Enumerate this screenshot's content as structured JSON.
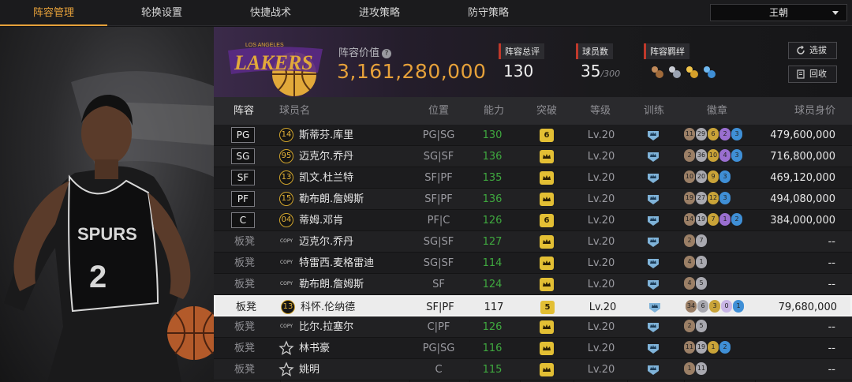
{
  "tabs": [
    {
      "label": "阵容管理",
      "active": true
    },
    {
      "label": "轮换设置",
      "active": false
    },
    {
      "label": "快捷战术",
      "active": false
    },
    {
      "label": "进攻策略",
      "active": false
    },
    {
      "label": "防守策略",
      "active": false
    }
  ],
  "team_select": {
    "value": "王朝"
  },
  "header": {
    "logo_icon": "lakers-logo",
    "value_label": "阵容价值",
    "value_help_icon": "help-icon",
    "value_amount": "3,161,280,000",
    "rating_label": "阵容总评",
    "rating_value": "130",
    "count_label": "球员数",
    "count_value": "35",
    "count_max": "/300",
    "bond_label": "阵容羁绊",
    "bond_icons": [
      "bond-icon-bronze",
      "bond-icon-silver",
      "bond-icon-gold",
      "bond-icon-blue"
    ]
  },
  "buttons": {
    "select": "选拔",
    "recycle": "回收"
  },
  "columns": {
    "lineup": "阵容",
    "name": "球员名",
    "position": "位置",
    "power": "能力",
    "breakthrough": "突破",
    "level": "等级",
    "training": "训练",
    "badges": "徽章",
    "value": "球员身价"
  },
  "colors": {
    "accent": "#e6a13a",
    "power": "#3fa83f",
    "break": "#e3bf34"
  },
  "players": [
    {
      "slot": "PG",
      "starter": true,
      "num": "14",
      "name": "斯蒂芬.库里",
      "pos": "PG|SG",
      "power": "130",
      "brk": "6",
      "level": "Lv.20",
      "badges": [
        {
          "v": "11",
          "c": "#9b7f66"
        },
        {
          "v": "29",
          "c": "#a9a9b0"
        },
        {
          "v": "6",
          "c": "#c9a338"
        },
        {
          "v": "2",
          "c": "#9a6fd0"
        },
        {
          "v": "3",
          "c": "#3f8fd6"
        }
      ],
      "price": "479,600,000"
    },
    {
      "slot": "SG",
      "starter": true,
      "num": "95",
      "name": "迈克尔.乔丹",
      "pos": "SG|SF",
      "power": "136",
      "brk": "",
      "level": "Lv.20",
      "badges": [
        {
          "v": "2",
          "c": "#9b7f66"
        },
        {
          "v": "36",
          "c": "#a9a9b0"
        },
        {
          "v": "10",
          "c": "#c9a338"
        },
        {
          "v": "4",
          "c": "#9a6fd0"
        },
        {
          "v": "3",
          "c": "#3f8fd6"
        }
      ],
      "price": "716,800,000"
    },
    {
      "slot": "SF",
      "starter": true,
      "num": "13",
      "name": "凯文.杜兰特",
      "pos": "SF|PF",
      "power": "135",
      "brk": "",
      "level": "Lv.20",
      "badges": [
        {
          "v": "10",
          "c": "#9b7f66"
        },
        {
          "v": "20",
          "c": "#a9a9b0"
        },
        {
          "v": "9",
          "c": "#c9a338"
        },
        {
          "v": "3",
          "c": "#3f8fd6"
        }
      ],
      "price": "469,120,000"
    },
    {
      "slot": "PF",
      "starter": true,
      "num": "15",
      "name": "勒布朗.詹姆斯",
      "pos": "SF|PF",
      "power": "136",
      "brk": "",
      "level": "Lv.20",
      "badges": [
        {
          "v": "19",
          "c": "#9b7f66"
        },
        {
          "v": "27",
          "c": "#a9a9b0"
        },
        {
          "v": "12",
          "c": "#c9a338"
        },
        {
          "v": "3",
          "c": "#3f8fd6"
        }
      ],
      "price": "494,080,000"
    },
    {
      "slot": "C",
      "starter": true,
      "num": "04",
      "name": "蒂姆.邓肯",
      "pos": "PF|C",
      "power": "126",
      "brk": "6",
      "level": "Lv.20",
      "badges": [
        {
          "v": "14",
          "c": "#9b7f66"
        },
        {
          "v": "19",
          "c": "#a9a9b0"
        },
        {
          "v": "7",
          "c": "#c9a338"
        },
        {
          "v": "1",
          "c": "#9a6fd0"
        },
        {
          "v": "2",
          "c": "#3f8fd6"
        }
      ],
      "price": "384,000,000"
    },
    {
      "slot": "板凳",
      "starter": false,
      "mark": "COPY",
      "name": "迈克尔.乔丹",
      "pos": "SG|SF",
      "power": "127",
      "brk": "",
      "level": "Lv.20",
      "badges": [
        {
          "v": "2",
          "c": "#9b7f66"
        },
        {
          "v": "7",
          "c": "#a9a9b0"
        }
      ],
      "price": "--"
    },
    {
      "slot": "板凳",
      "starter": false,
      "mark": "COPY",
      "name": "特雷西.麦格雷迪",
      "pos": "SG|SF",
      "power": "114",
      "brk": "",
      "level": "Lv.20",
      "badges": [
        {
          "v": "4",
          "c": "#9b7f66"
        },
        {
          "v": "1",
          "c": "#a9a9b0"
        }
      ],
      "price": "--"
    },
    {
      "slot": "板凳",
      "starter": false,
      "mark": "COPY",
      "name": "勒布朗.詹姆斯",
      "pos": "SF",
      "power": "124",
      "brk": "",
      "level": "Lv.20",
      "badges": [
        {
          "v": "4",
          "c": "#9b7f66"
        },
        {
          "v": "5",
          "c": "#a9a9b0"
        }
      ],
      "price": "--"
    },
    {
      "slot": "板凳",
      "starter": false,
      "selected": true,
      "num": "13",
      "name": "科怀.伦纳德",
      "pos": "SF|PF",
      "power": "117",
      "brk": "5",
      "level": "Lv.20",
      "badges": [
        {
          "v": "34",
          "c": "#9b7f66"
        },
        {
          "v": "6",
          "c": "#a9a9b0"
        },
        {
          "v": "3",
          "c": "#c9a338"
        },
        {
          "v": "0",
          "c": "#c9b6e6"
        },
        {
          "v": "1",
          "c": "#3f8fd6"
        }
      ],
      "price": "79,680,000"
    },
    {
      "slot": "板凳",
      "starter": false,
      "mark": "COPY",
      "name": "比尔.拉塞尔",
      "pos": "C|PF",
      "power": "126",
      "brk": "",
      "level": "Lv.20",
      "badges": [
        {
          "v": "2",
          "c": "#9b7f66"
        },
        {
          "v": "5",
          "c": "#a9a9b0"
        }
      ],
      "price": "--"
    },
    {
      "slot": "板凳",
      "starter": false,
      "mark": "STAR",
      "name": "林书豪",
      "pos": "PG|SG",
      "power": "116",
      "brk": "",
      "level": "Lv.20",
      "badges": [
        {
          "v": "11",
          "c": "#9b7f66"
        },
        {
          "v": "19",
          "c": "#a9a9b0"
        },
        {
          "v": "1",
          "c": "#c9a338"
        },
        {
          "v": "2",
          "c": "#3f8fd6"
        }
      ],
      "price": "--"
    },
    {
      "slot": "板凳",
      "starter": false,
      "mark": "STAR",
      "name": "姚明",
      "pos": "C",
      "power": "115",
      "brk": "",
      "level": "Lv.20",
      "badges": [
        {
          "v": "1",
          "c": "#9b7f66"
        },
        {
          "v": "11",
          "c": "#a9a9b0"
        }
      ],
      "price": "--"
    }
  ]
}
